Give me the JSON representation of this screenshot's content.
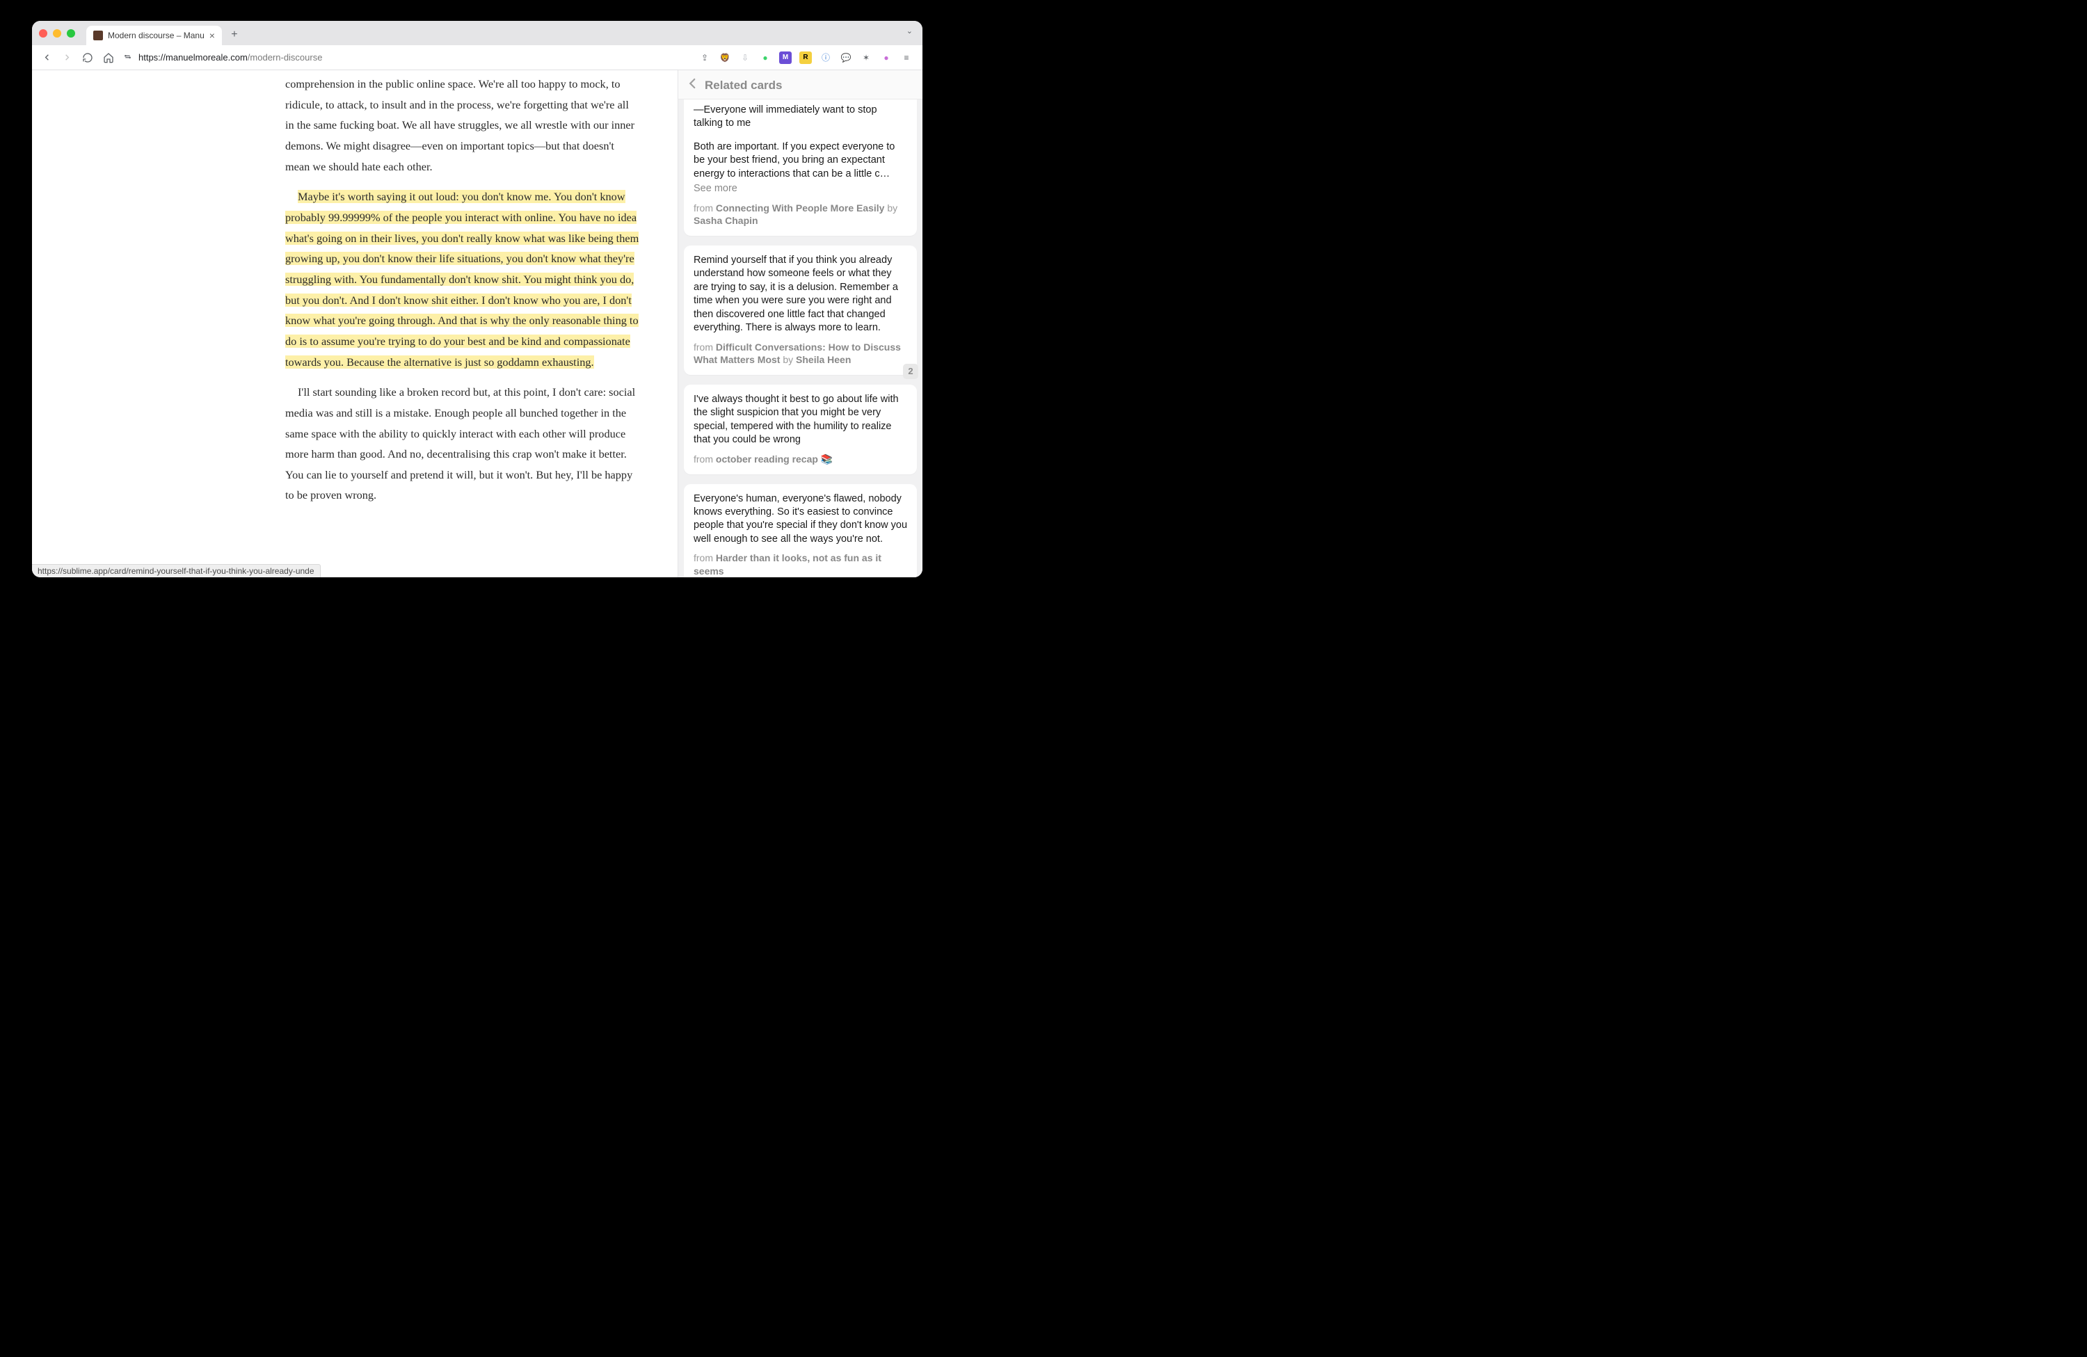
{
  "window": {
    "tab_title": "Modern discourse – Manu",
    "url_host": "https://manuelmoreale.com",
    "url_path": "/modern-discourse",
    "new_tab_glyph": "+",
    "tab_close_glyph": "×",
    "chevron_glyph": "⌄"
  },
  "toolbar": {
    "extensions": [
      {
        "name": "share",
        "glyph": "⇪",
        "color": "#5f6368",
        "bg": "transparent"
      },
      {
        "name": "brave-shield",
        "glyph": "🦁",
        "color": "#fb542b",
        "bg": "transparent"
      },
      {
        "name": "ext-download",
        "glyph": "⇩",
        "color": "#b6b9c0",
        "bg": "transparent"
      },
      {
        "name": "ext-green-dot",
        "glyph": "●",
        "color": "#3bd36b",
        "bg": "transparent"
      },
      {
        "name": "ext-purple-m",
        "glyph": "M",
        "color": "#fff",
        "bg": "#6b4ed6"
      },
      {
        "name": "ext-yellow-r",
        "glyph": "R",
        "color": "#000",
        "bg": "#f4d03f"
      },
      {
        "name": "ext-info",
        "glyph": "ⓘ",
        "color": "#3a7bd5",
        "bg": "transparent"
      },
      {
        "name": "ext-chat",
        "glyph": "💬",
        "color": "#5f6368",
        "bg": "transparent"
      },
      {
        "name": "ext-puzzle",
        "glyph": "✶",
        "color": "#5f6368",
        "bg": "transparent"
      },
      {
        "name": "ext-gradient",
        "glyph": "●",
        "color": "#c86dd7",
        "bg": "transparent"
      },
      {
        "name": "hamburger",
        "glyph": "≡",
        "color": "#5f6368",
        "bg": "transparent"
      }
    ]
  },
  "article": {
    "p1": "comprehension in the public online space. We're all too happy to mock, to ridicule, to attack, to insult and in the process, we're forgetting that we're all in the same fucking boat. We all have struggles, we all wrestle with our inner demons. We might disagree—even on important topics—but that doesn't mean we should hate each other.",
    "p2_hl": "Maybe it's worth saying it out loud: you don't know me. You don't know probably 99.99999% of the people you interact with online. You have no idea what's going on in their lives, you don't really know what was like being them growing up, you don't know their life situations, you don't know what they're struggling with. You fundamentally don't know shit. You might think you do, but you don't. And I don't know shit either. I don't know who you are, I don't know what you're going through. And that is why the only reasonable thing to do is to assume you're trying to do your best and be kind and compassionate towards you. Because the alternative is just so goddamn exhausting.",
    "p3": "I'll start sounding like a broken record but, at this point, I don't care: social media was and still is a mistake. Enough people all bunched together in the same space with the ability to quickly interact with each other will produce more harm than good. And no, decentralising this crap won't make it better. You can lie to yourself and pretend it will, but it won't. But hey, I'll be happy to be proven wrong."
  },
  "sidebar": {
    "header": "Related cards",
    "back_glyph": "‹",
    "cards": [
      {
        "excerpt": "—Everyone will immediately want to stop talking to me",
        "truncated": false,
        "more": "Both are important. If you expect everyone to be your best friend, you bring an expectant energy to interactions that can be a little c…",
        "see_more_label": "See more",
        "from_prefix": "from ",
        "source_title": "Connecting With People More Easily",
        "by_label": " by ",
        "author": "Sasha Chapin"
      },
      {
        "excerpt": "Remind yourself that if you think you already understand how someone feels or what they are trying to say, it is a delusion. Remember a time when you were sure you were right and then discovered one little fact that changed everything. There is always more to learn.",
        "from_prefix": "from ",
        "source_title": "Difficult Conversations: How to Discuss What Matters Most",
        "by_label": " by ",
        "author": "Sheila Heen",
        "count": "2"
      },
      {
        "excerpt": "I've always thought it best to go about life with the slight suspicion that you might be very special, tempered with the humility to realize that you could be wrong",
        "from_prefix": "from ",
        "source_title": "october reading recap 📚",
        "by_label": "",
        "author": ""
      },
      {
        "excerpt": "Everyone's human, everyone's flawed, nobody knows everything. So it's easiest to convince people that you're special if they don't know you well enough to see all the ways you're not.",
        "from_prefix": "from ",
        "source_title": "Harder than it looks, not as fun as it seems",
        "by_label": "",
        "author": ""
      }
    ]
  },
  "status_bar": "https://sublime.app/card/remind-yourself-that-if-you-think-you-already-unde"
}
